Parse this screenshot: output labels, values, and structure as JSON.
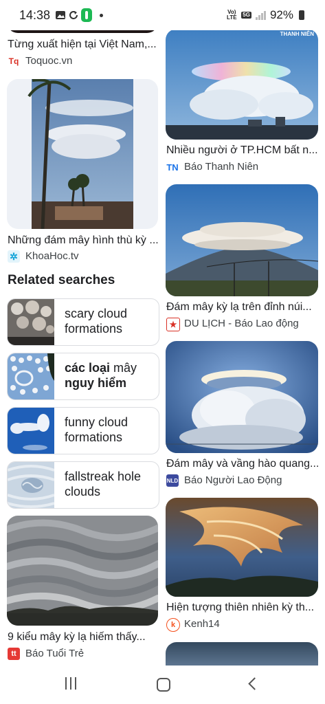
{
  "status_bar": {
    "time": "14:38",
    "battery": "92%",
    "network": "Vo) LTE",
    "signal": "5G"
  },
  "results": [
    {
      "caption": "Từng xuất hiện tại Việt Nam,...",
      "source": "Toquoc.vn",
      "favicon_text": "Tq",
      "favicon_color": "#d93025"
    },
    {
      "caption": "Nhiều người ở TP.HCM bất n...",
      "source": "Báo Thanh Niên",
      "favicon_text": "TN",
      "favicon_color": "#1a73e8"
    },
    {
      "caption": "Những đám mây hình thù kỳ ...",
      "source": "KhoaHoc.tv",
      "favicon_text": "✲",
      "favicon_color": "#12a4d9"
    },
    {
      "caption": "Đám mây kỳ lạ trên đỉnh núi...",
      "source": "DU LỊCH - Báo Lao động",
      "favicon_text": "★",
      "favicon_color": "#d93025"
    },
    {
      "caption": "Đám mây và vầng hào quang...",
      "source": "Báo Người Lao Động",
      "favicon_text": "NLD",
      "favicon_color": "#3c4a9e"
    },
    {
      "caption": "9 kiểu mây kỳ lạ hiếm thấy...",
      "source": "Báo Tuổi Trẻ",
      "favicon_text": "tt",
      "favicon_color": "#e53935"
    },
    {
      "caption": "Hiện tượng thiên nhiên kỳ th...",
      "source": "Kenh14",
      "favicon_text": "k",
      "favicon_color": "#f4511e"
    }
  ],
  "related": {
    "title": "Related searches",
    "items": [
      {
        "plain": "scary cloud formations"
      },
      {
        "bold1": "các loại",
        "plain1": " mây ",
        "bold2": "nguy hiểm"
      },
      {
        "plain": "funny cloud formations"
      },
      {
        "plain": "fallstreak hole clouds"
      }
    ]
  },
  "image_watermark": "THANH NIÊN"
}
